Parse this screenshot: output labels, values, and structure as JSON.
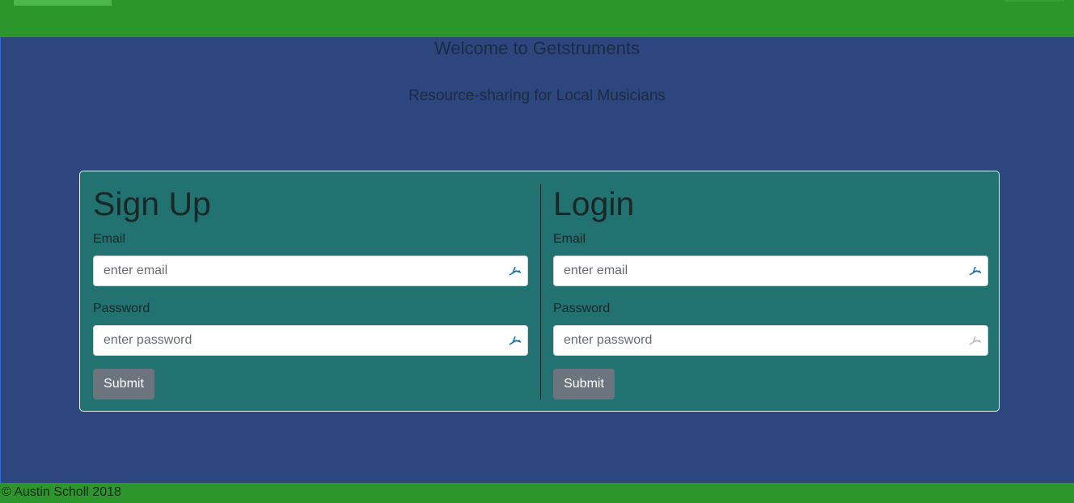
{
  "header": {
    "title": "Welcome to Getstruments",
    "subtitle": "Resource-sharing for Local Musicians"
  },
  "signup": {
    "heading": "Sign Up",
    "email_label": "Email",
    "email_placeholder": "enter email",
    "password_label": "Password",
    "password_placeholder": "enter password",
    "submit_label": "Submit"
  },
  "login": {
    "heading": "Login",
    "email_label": "Email",
    "email_placeholder": "enter email",
    "password_label": "Password",
    "password_placeholder": "enter password",
    "submit_label": "Submit"
  },
  "footer": {
    "text": "© Austin Scholl 2018"
  },
  "colors": {
    "nav_bar": "#2c962c",
    "page_background": "#2d467d",
    "panel_background": "#217271",
    "submit_button": "#6c757d"
  },
  "icons": {
    "autofill": "password-manager-fill-icon"
  }
}
